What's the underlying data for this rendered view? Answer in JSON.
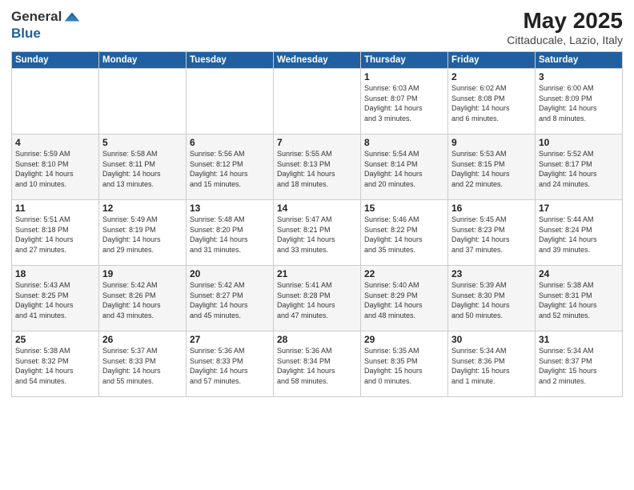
{
  "header": {
    "logo_line1": "General",
    "logo_line2": "Blue",
    "title": "May 2025",
    "location": "Cittaducale, Lazio, Italy"
  },
  "days_of_week": [
    "Sunday",
    "Monday",
    "Tuesday",
    "Wednesday",
    "Thursday",
    "Friday",
    "Saturday"
  ],
  "weeks": [
    [
      {
        "day": "",
        "info": ""
      },
      {
        "day": "",
        "info": ""
      },
      {
        "day": "",
        "info": ""
      },
      {
        "day": "",
        "info": ""
      },
      {
        "day": "1",
        "info": "Sunrise: 6:03 AM\nSunset: 8:07 PM\nDaylight: 14 hours\nand 3 minutes."
      },
      {
        "day": "2",
        "info": "Sunrise: 6:02 AM\nSunset: 8:08 PM\nDaylight: 14 hours\nand 6 minutes."
      },
      {
        "day": "3",
        "info": "Sunrise: 6:00 AM\nSunset: 8:09 PM\nDaylight: 14 hours\nand 8 minutes."
      }
    ],
    [
      {
        "day": "4",
        "info": "Sunrise: 5:59 AM\nSunset: 8:10 PM\nDaylight: 14 hours\nand 10 minutes."
      },
      {
        "day": "5",
        "info": "Sunrise: 5:58 AM\nSunset: 8:11 PM\nDaylight: 14 hours\nand 13 minutes."
      },
      {
        "day": "6",
        "info": "Sunrise: 5:56 AM\nSunset: 8:12 PM\nDaylight: 14 hours\nand 15 minutes."
      },
      {
        "day": "7",
        "info": "Sunrise: 5:55 AM\nSunset: 8:13 PM\nDaylight: 14 hours\nand 18 minutes."
      },
      {
        "day": "8",
        "info": "Sunrise: 5:54 AM\nSunset: 8:14 PM\nDaylight: 14 hours\nand 20 minutes."
      },
      {
        "day": "9",
        "info": "Sunrise: 5:53 AM\nSunset: 8:15 PM\nDaylight: 14 hours\nand 22 minutes."
      },
      {
        "day": "10",
        "info": "Sunrise: 5:52 AM\nSunset: 8:17 PM\nDaylight: 14 hours\nand 24 minutes."
      }
    ],
    [
      {
        "day": "11",
        "info": "Sunrise: 5:51 AM\nSunset: 8:18 PM\nDaylight: 14 hours\nand 27 minutes."
      },
      {
        "day": "12",
        "info": "Sunrise: 5:49 AM\nSunset: 8:19 PM\nDaylight: 14 hours\nand 29 minutes."
      },
      {
        "day": "13",
        "info": "Sunrise: 5:48 AM\nSunset: 8:20 PM\nDaylight: 14 hours\nand 31 minutes."
      },
      {
        "day": "14",
        "info": "Sunrise: 5:47 AM\nSunset: 8:21 PM\nDaylight: 14 hours\nand 33 minutes."
      },
      {
        "day": "15",
        "info": "Sunrise: 5:46 AM\nSunset: 8:22 PM\nDaylight: 14 hours\nand 35 minutes."
      },
      {
        "day": "16",
        "info": "Sunrise: 5:45 AM\nSunset: 8:23 PM\nDaylight: 14 hours\nand 37 minutes."
      },
      {
        "day": "17",
        "info": "Sunrise: 5:44 AM\nSunset: 8:24 PM\nDaylight: 14 hours\nand 39 minutes."
      }
    ],
    [
      {
        "day": "18",
        "info": "Sunrise: 5:43 AM\nSunset: 8:25 PM\nDaylight: 14 hours\nand 41 minutes."
      },
      {
        "day": "19",
        "info": "Sunrise: 5:42 AM\nSunset: 8:26 PM\nDaylight: 14 hours\nand 43 minutes."
      },
      {
        "day": "20",
        "info": "Sunrise: 5:42 AM\nSunset: 8:27 PM\nDaylight: 14 hours\nand 45 minutes."
      },
      {
        "day": "21",
        "info": "Sunrise: 5:41 AM\nSunset: 8:28 PM\nDaylight: 14 hours\nand 47 minutes."
      },
      {
        "day": "22",
        "info": "Sunrise: 5:40 AM\nSunset: 8:29 PM\nDaylight: 14 hours\nand 48 minutes."
      },
      {
        "day": "23",
        "info": "Sunrise: 5:39 AM\nSunset: 8:30 PM\nDaylight: 14 hours\nand 50 minutes."
      },
      {
        "day": "24",
        "info": "Sunrise: 5:38 AM\nSunset: 8:31 PM\nDaylight: 14 hours\nand 52 minutes."
      }
    ],
    [
      {
        "day": "25",
        "info": "Sunrise: 5:38 AM\nSunset: 8:32 PM\nDaylight: 14 hours\nand 54 minutes."
      },
      {
        "day": "26",
        "info": "Sunrise: 5:37 AM\nSunset: 8:33 PM\nDaylight: 14 hours\nand 55 minutes."
      },
      {
        "day": "27",
        "info": "Sunrise: 5:36 AM\nSunset: 8:33 PM\nDaylight: 14 hours\nand 57 minutes."
      },
      {
        "day": "28",
        "info": "Sunrise: 5:36 AM\nSunset: 8:34 PM\nDaylight: 14 hours\nand 58 minutes."
      },
      {
        "day": "29",
        "info": "Sunrise: 5:35 AM\nSunset: 8:35 PM\nDaylight: 15 hours\nand 0 minutes."
      },
      {
        "day": "30",
        "info": "Sunrise: 5:34 AM\nSunset: 8:36 PM\nDaylight: 15 hours\nand 1 minute."
      },
      {
        "day": "31",
        "info": "Sunrise: 5:34 AM\nSunset: 8:37 PM\nDaylight: 15 hours\nand 2 minutes."
      }
    ]
  ]
}
